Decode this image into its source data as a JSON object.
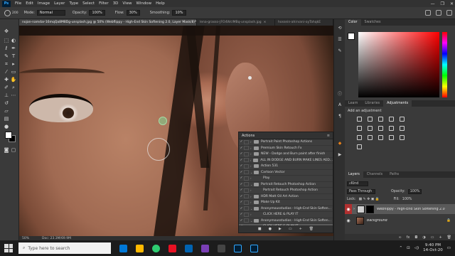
{
  "menubar": {
    "logo": "Ps",
    "items": [
      "File",
      "Edit",
      "Image",
      "Layer",
      "Type",
      "Select",
      "Filter",
      "3D",
      "View",
      "Window",
      "Help"
    ],
    "window_controls": [
      "—",
      "❐",
      "✕"
    ]
  },
  "options_bar": {
    "brush_size": "200",
    "mode_label": "Mode:",
    "mode_value": "Normal",
    "opacity_label": "Opacity:",
    "opacity_value": "100%",
    "flow_label": "Flow:",
    "flow_value": "30%",
    "smoothing_label": "Smoothing:",
    "smoothing_value": "10%"
  },
  "tabs": [
    {
      "label": "nojan-namdar-16mqQa8M8Dg-unsplash.jpg @ 50% (Webflippy - High-End Skin Softening 2.0, Layer Mask/8)*",
      "active": true
    },
    {
      "label": "lena-grasso-JFO4WclMBq-unsplash.jpg",
      "active": false
    },
    {
      "label": "hossein-ahirvani-oyTahqkE",
      "active": false
    }
  ],
  "status": {
    "zoom": "50%",
    "doc_info": "Doc: 23.3M/69.9M"
  },
  "actions_panel": {
    "title": "Actions",
    "rows": [
      {
        "label": "Portrait Paint Photoshop Actions",
        "type": "set"
      },
      {
        "label": "Premium Skin Retouch Fx",
        "type": "set"
      },
      {
        "label": "NEW - Dodge and Burn paint after finish",
        "type": "set"
      },
      {
        "label": "ALL IN DODGE AND BURN MAKE LINES AED...",
        "type": "set"
      },
      {
        "label": "Action 531",
        "type": "set"
      },
      {
        "label": "Cartoon Vector",
        "type": "set"
      },
      {
        "label": "Play",
        "type": "sub"
      },
      {
        "label": "Portrait Retouch Photoshop Action",
        "type": "set"
      },
      {
        "label": "Portrait Retouch Photoshop Action",
        "type": "sub"
      },
      {
        "label": "HDR Matt Oil Art Action",
        "type": "set"
      },
      {
        "label": "Make Up Kit",
        "type": "set"
      },
      {
        "label": "Anonymousstudios - High-End Skin Soften...",
        "type": "set"
      },
      {
        "label": "CLICK HERE & PLAY IT",
        "type": "sub"
      },
      {
        "label": "Anonymousstudios - High-End Skin Soften...",
        "type": "set"
      },
      {
        "label": "CLICK HERE & PLAY IT",
        "type": "sub-highlight"
      }
    ],
    "footer_icons": [
      "■",
      "●",
      "▶",
      "▭",
      "+",
      "🗑"
    ]
  },
  "right_panels": {
    "color_tabs": [
      "Color",
      "Swatches"
    ],
    "adjust_tabs": [
      "Learn",
      "Libraries",
      "Adjustments"
    ],
    "adjust_title": "Add an adjustment",
    "layers_tabs": [
      "Layers",
      "Channels",
      "Paths"
    ],
    "kind_label": "Kind",
    "blend_mode": "Pass Through",
    "opacity_label": "Opacity:",
    "opacity_value": "100%",
    "lock_label": "Lock:",
    "fill_label": "Fill:",
    "fill_value": "100%",
    "layers": [
      {
        "name": "Webflippy - High-End Skin Softening 2.0",
        "selected": true
      },
      {
        "name": "Background",
        "selected": false
      }
    ]
  },
  "taskbar": {
    "search_placeholder": "Type here to search",
    "time": "9:40 PM",
    "date": "14-Oct-20"
  },
  "colors": {
    "accent": "#31a8ff",
    "canvas_bg": "#c9cfd2",
    "selected_layer": "#595959"
  }
}
